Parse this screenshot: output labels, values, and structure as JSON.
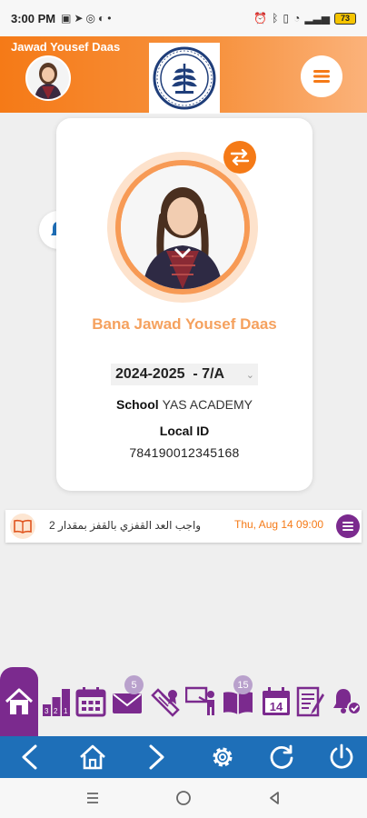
{
  "status_bar": {
    "time": "3:00 PM",
    "left_icons": [
      "sim-icon",
      "telegram-icon",
      "whatsapp-icon",
      "notification-icon",
      "usb-icon"
    ],
    "right_icons": [
      "alarm-icon",
      "bluetooth-icon",
      "vibrate-icon",
      "wifi-icon",
      "signal-icon"
    ],
    "battery": "73"
  },
  "header": {
    "parent_name": "Jawad Yousef Daas",
    "accent_color": "#f57a17"
  },
  "notifications": {
    "count": "0"
  },
  "student": {
    "name": "Bana Jawad Yousef Daas",
    "academic_year": "2024-2025  - 7/A",
    "school_label": "School",
    "school_value": "YAS ACADEMY",
    "local_id_label": "Local ID",
    "local_id_value": "784190012345168"
  },
  "homework": {
    "text": "واجب العد القفزي بالقفز بمقدار 2",
    "date": "Thu, Aug 14 09:00"
  },
  "modules": [
    {
      "name": "home-icon",
      "badge": ""
    },
    {
      "name": "grades-icon",
      "badge": ""
    },
    {
      "name": "calendar-icon",
      "badge": ""
    },
    {
      "name": "messages-icon",
      "badge": "5"
    },
    {
      "name": "certificate-icon",
      "badge": ""
    },
    {
      "name": "teacher-icon",
      "badge": ""
    },
    {
      "name": "homework-book-icon",
      "badge": "15"
    },
    {
      "name": "events-calendar-icon",
      "badge": "",
      "day": "14"
    },
    {
      "name": "notes-icon",
      "badge": ""
    },
    {
      "name": "alerts-icon",
      "badge": ""
    }
  ],
  "nav_bar": [
    "back-icon",
    "home-icon",
    "forward-icon",
    "settings-icon",
    "refresh-icon",
    "power-icon"
  ],
  "colors": {
    "purple": "#7b2a8e",
    "orange": "#f57a17",
    "blue": "#1e6fb8"
  }
}
